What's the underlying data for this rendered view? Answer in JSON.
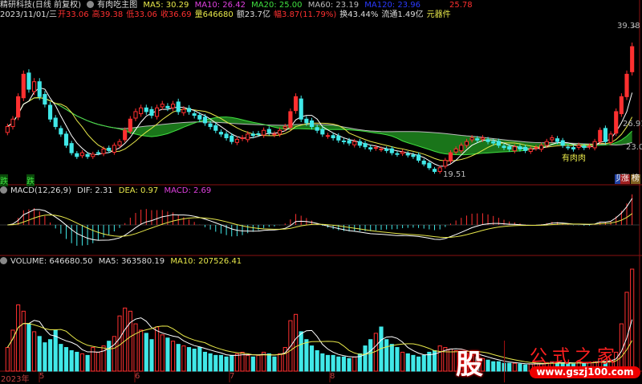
{
  "header": {
    "stock_name": "精研科技(日线 前复权)",
    "indicator_name": "有肉吃主图",
    "ma5": "MA5: 30.29",
    "ma10": "MA10: 26.42",
    "ma20": "MA20: 25.00",
    "ma60": "MA60: 23.19",
    "ma120": "MA120: 23.96",
    "right_value": "25.78",
    "date": "2023/11/01/三",
    "open": "开33.06",
    "high": "高39.38",
    "low": "低33.06",
    "close": "收36.69",
    "volume": "量646680",
    "amount": "额23.7亿",
    "change": "幅3.87(11.79%)",
    "turnover": "换43.44%",
    "float": "流通1.49亿",
    "sector": "元器件"
  },
  "main_chart": {
    "high_label": "39.38",
    "low_label": "19.51",
    "marker_label_1": "26.91",
    "marker_label_2": "23.08",
    "signal_text": "有肉肉",
    "fall_label": "跌",
    "left_label": "跌",
    "buttons": [
      "贝",
      "涨",
      "榜"
    ]
  },
  "macd": {
    "title": "MACD(12,26,9)",
    "dif": "DIF: 2.31",
    "dea": "DEA: 0.97",
    "macd": "MACD: 2.69"
  },
  "volume_panel": {
    "title": "VOLUME: 646680.50",
    "ma5": "MA5: 363580.19",
    "ma10": "MA10: 207526.41"
  },
  "time_axis": [
    "2023年",
    "5",
    "6",
    "7",
    "8"
  ],
  "logo": {
    "char": "股",
    "name": "公式之家",
    "url": "www.gszj100.com"
  },
  "colors": {
    "up": "#ff3030",
    "down": "#40e8e8",
    "ma5": "#ffffff",
    "ma10": "#e8e84a",
    "ma20": "#40e040",
    "ma60": "#bbbbbb",
    "band": "#1f8a1f"
  },
  "chart_data": {
    "type": "candlestick",
    "closes": [
      26,
      27,
      30,
      33,
      31,
      32,
      30,
      29,
      27,
      26,
      25,
      23.5,
      22.5,
      22,
      22.5,
      22,
      22.3,
      22.5,
      23,
      22.8,
      23.5,
      24,
      25.5,
      27,
      28,
      28.5,
      28,
      27.5,
      28.5,
      29,
      28.5,
      29,
      28,
      28.3,
      28,
      27.5,
      27,
      26.5,
      26,
      25.5,
      25,
      24.5,
      24,
      24.3,
      24.5,
      25,
      24.8,
      25,
      25.5,
      25.2,
      25,
      25.5,
      26,
      28,
      30,
      27,
      26.5,
      26,
      25.5,
      25,
      24.8,
      24.5,
      24.2,
      24,
      23.8,
      24,
      23.5,
      23.3,
      23,
      23.2,
      23,
      22.8,
      22.5,
      22.3,
      22.6,
      22.2,
      22,
      21.5,
      21,
      20.5,
      20,
      20.5,
      21.5,
      22.5,
      23,
      23.5,
      24,
      24.5,
      24.2,
      24.5,
      24,
      23.8,
      23.5,
      23.2,
      23,
      23.3,
      23,
      22.8,
      23,
      23.2,
      23.5,
      24,
      24.5,
      24,
      23.5,
      23.2,
      23,
      23.5,
      23.2,
      23.4,
      24,
      25.5,
      24,
      25,
      28,
      30,
      33,
      36.69
    ],
    "volumes": [
      150000,
      260000,
      420000,
      380000,
      300000,
      250000,
      220000,
      180000,
      200000,
      260000,
      170000,
      150000,
      130000,
      120000,
      110000,
      100000,
      150000,
      120000,
      160000,
      190000,
      220000,
      350000,
      400000,
      380000,
      300000,
      260000,
      240000,
      200000,
      280000,
      230000,
      210000,
      190000,
      170000,
      160000,
      150000,
      140000,
      150000,
      120000,
      110000,
      100000,
      100000,
      90000,
      100000,
      110000,
      120000,
      100000,
      90000,
      100000,
      120000,
      110000,
      90000,
      110000,
      150000,
      320000,
      360000,
      250000,
      200000,
      160000,
      130000,
      110000,
      100000,
      100000,
      90000,
      90000,
      80000,
      90000,
      110000,
      160000,
      200000,
      240000,
      280000,
      200000,
      170000,
      150000,
      120000,
      110000,
      100000,
      90000,
      100000,
      120000,
      130000,
      160000,
      150000,
      140000,
      130000,
      120000,
      110000,
      100000,
      90000,
      80000,
      70000,
      60000,
      60000,
      50000,
      50000,
      50000,
      45000,
      40000,
      45000,
      50000,
      50000,
      55000,
      60000,
      55000,
      50000,
      50000,
      45000,
      60000,
      50000,
      55000,
      60000,
      80000,
      60000,
      70000,
      120000,
      300000,
      500000,
      646680
    ],
    "price_range": [
      19.51,
      39.38
    ],
    "volume_max": 646680
  }
}
